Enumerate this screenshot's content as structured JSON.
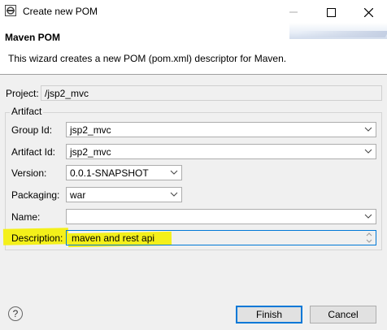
{
  "window": {
    "title": "Create new POM"
  },
  "header": {
    "title": "Maven POM",
    "message": "This wizard creates a new POM (pom.xml) descriptor for Maven."
  },
  "project": {
    "label": "Project:",
    "value": "/jsp2_mvc"
  },
  "artifact": {
    "group_label": "Artifact",
    "group_id": {
      "label": "Group Id:",
      "value": "jsp2_mvc"
    },
    "artifact_id": {
      "label": "Artifact Id:",
      "value": "jsp2_mvc"
    },
    "version": {
      "label": "Version:",
      "value": "0.0.1-SNAPSHOT"
    },
    "packaging": {
      "label": "Packaging:",
      "value": "war"
    },
    "name": {
      "label": "Name:",
      "value": ""
    },
    "description": {
      "label": "Description:",
      "value": "maven and rest api"
    }
  },
  "buttons": {
    "help": "?",
    "finish": "Finish",
    "cancel": "Cancel"
  },
  "colors": {
    "highlight": "#f4f01a",
    "focus_border": "#0078d7"
  }
}
